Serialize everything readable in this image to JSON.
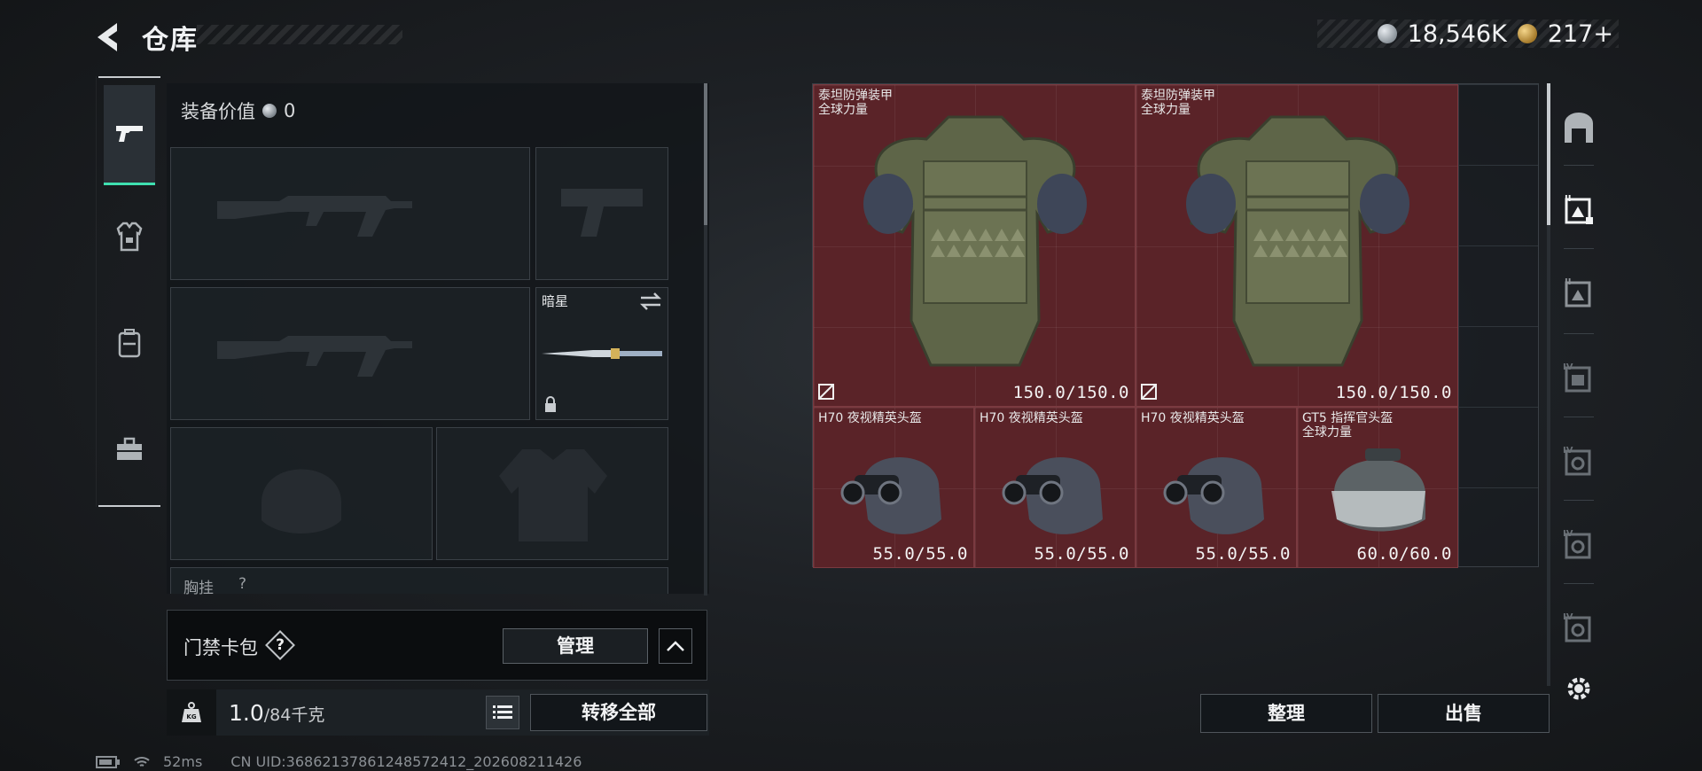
{
  "header": {
    "title": "仓库",
    "currency_silver": "18,546K",
    "currency_gold": "217+"
  },
  "left_tabs": [
    {
      "name": "weapons",
      "icon": "pistol-icon",
      "active": true
    },
    {
      "name": "armor",
      "icon": "armor-icon",
      "active": false
    },
    {
      "name": "backpack",
      "icon": "backpack-icon",
      "active": false
    },
    {
      "name": "toolbox",
      "icon": "toolbox-icon",
      "active": false
    }
  ],
  "loadout": {
    "equip_value_label": "装备价值",
    "equip_value": "0",
    "melee_name": "暗星",
    "chest_rig_label": "胸挂",
    "chest_rig_count": "?"
  },
  "card_bar": {
    "label": "门禁卡包",
    "help": "?",
    "manage": "管理"
  },
  "weight": {
    "current": "1.0",
    "max": "/84千克",
    "transfer_all": "转移全部"
  },
  "stash": {
    "items": [
      {
        "name": "泰坦防弹装甲",
        "sub": "全球力量",
        "durability": "150.0/150.0",
        "type": "armor"
      },
      {
        "name": "泰坦防弹装甲",
        "sub": "全球力量",
        "durability": "150.0/150.0",
        "type": "armor"
      },
      {
        "name": "H70 夜视精英头盔",
        "sub": "",
        "durability": "55.0/55.0",
        "type": "helmet-nv"
      },
      {
        "name": "H70 夜视精英头盔",
        "sub": "",
        "durability": "55.0/55.0",
        "type": "helmet-nv"
      },
      {
        "name": "H70 夜视精英头盔",
        "sub": "",
        "durability": "55.0/55.0",
        "type": "helmet-nv"
      },
      {
        "name": "GT5 指挥官头盔",
        "sub": "全球力量",
        "durability": "60.0/60.0",
        "type": "helmet-cmd"
      }
    ],
    "sort": "整理",
    "sell": "出售"
  },
  "status": {
    "ping": "52ms",
    "uid": "CN UID:368621378612485​72412_202608211426"
  },
  "colors": {
    "accent": "#3fe0b0",
    "item_bg": "#5a2328"
  }
}
